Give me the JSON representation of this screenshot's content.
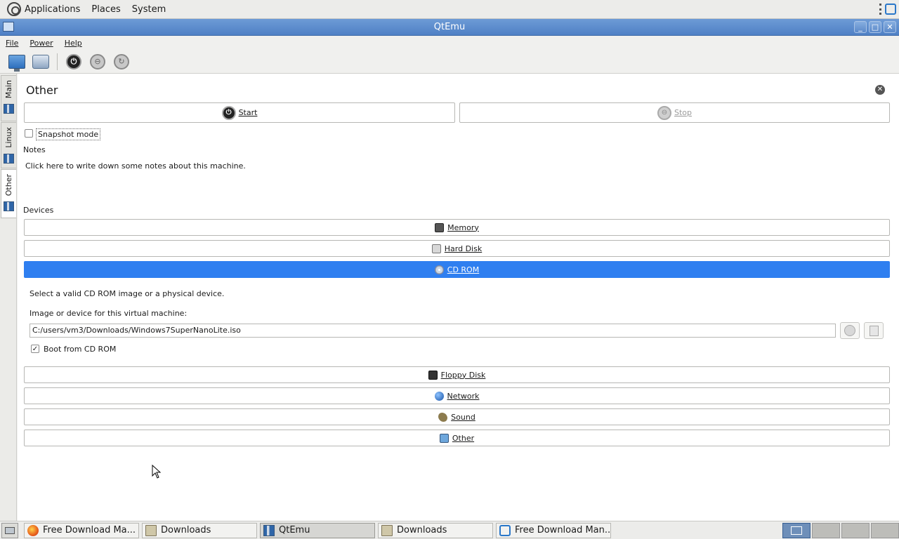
{
  "top_panel": {
    "menus": [
      "Applications",
      "Places",
      "System"
    ]
  },
  "window": {
    "title": "QtEmu",
    "buttons": [
      "_",
      "□",
      "✕"
    ]
  },
  "menubar": {
    "items": [
      "File",
      "Power",
      "Help"
    ]
  },
  "tabs": [
    {
      "label": "Main",
      "active": false
    },
    {
      "label": "Linux",
      "active": false
    },
    {
      "label": "Other",
      "active": true
    }
  ],
  "page": {
    "title": "Other",
    "start_label": "Start",
    "stop_label": "Stop",
    "snapshot_label": "Snapshot mode",
    "snapshot_checked": false,
    "notes_heading": "Notes",
    "notes_text": "Click here to write down some notes about this machine.",
    "devices_heading": "Devices"
  },
  "devices": {
    "memory": "Memory",
    "hard_disk": "Hard Disk",
    "cd_rom": "CD ROM",
    "floppy": "Floppy Disk",
    "network": "Network",
    "sound": "Sound",
    "other": "Other"
  },
  "cdrom_panel": {
    "instruction": "Select a valid CD ROM image or a physical device.",
    "field_label": "Image or device for this virtual machine:",
    "path_value": "C:/users/vm3/Downloads/Windows7SuperNanoLite.iso",
    "boot_label": "Boot from CD ROM",
    "boot_checked": true
  },
  "taskbar": {
    "tasks": [
      {
        "label": "Free Download Ma...",
        "icon": "firefox-icon"
      },
      {
        "label": "Downloads",
        "icon": "folder-icon"
      },
      {
        "label": "QtEmu",
        "icon": "qtemu-icon",
        "active": true
      },
      {
        "label": "Downloads",
        "icon": "folder-icon"
      },
      {
        "label": "Free Download Man...",
        "icon": "fdm-icon"
      }
    ]
  },
  "colors": {
    "selection_blue": "#2f7ff0",
    "titlebar_blue": "#5a8bcc"
  }
}
